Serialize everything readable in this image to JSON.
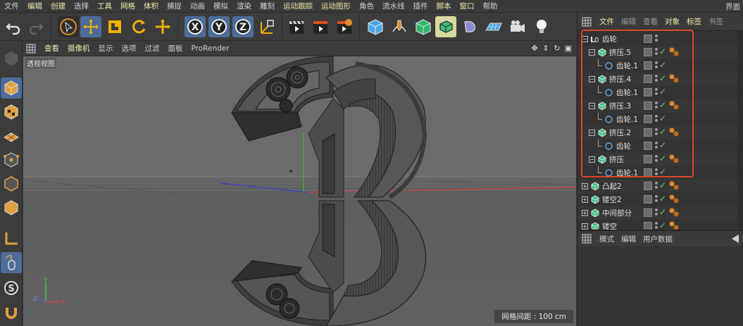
{
  "menu": {
    "items": [
      "文件",
      "编辑",
      "创建",
      "选择",
      "工具",
      "网格",
      "体积",
      "捕捉",
      "动画",
      "模拟",
      "渲染",
      "雕刻",
      "运动跟踪",
      "运动图形",
      "角色",
      "流水线",
      "插件",
      "脚本",
      "窗口",
      "帮助"
    ],
    "highlighted": [
      1,
      2,
      4,
      5,
      6,
      12,
      13,
      17,
      18
    ],
    "right_label": "界面"
  },
  "viewport_menu": {
    "items": [
      "查看",
      "摄像机",
      "显示",
      "选项",
      "过滤",
      "面板",
      "ProRender"
    ],
    "highlighted": [
      0,
      1
    ]
  },
  "viewport": {
    "label": "透视视图",
    "grid_spacing": "网格间距 : 100 cm",
    "axis_x": "X",
    "axis_y": "Y",
    "axis_z": "Z"
  },
  "object_manager": {
    "tabs": [
      "文件",
      "编辑",
      "查看",
      "对象",
      "标签",
      "书签"
    ],
    "highlighted_tabs": [
      0,
      3,
      4
    ],
    "rows": [
      {
        "name": "齿轮",
        "type": "null",
        "level": 0,
        "tag": false
      },
      {
        "name": "挤压.5",
        "type": "extrude",
        "level": 1,
        "tag": true
      },
      {
        "name": "齿轮.1",
        "type": "spline",
        "level": 2,
        "tag": false
      },
      {
        "name": "挤压.4",
        "type": "extrude",
        "level": 1,
        "tag": true
      },
      {
        "name": "齿轮.1",
        "type": "spline",
        "level": 2,
        "tag": false
      },
      {
        "name": "挤压.3",
        "type": "extrude",
        "level": 1,
        "tag": true
      },
      {
        "name": "齿轮.1",
        "type": "spline",
        "level": 2,
        "tag": false
      },
      {
        "name": "挤压.2",
        "type": "extrude",
        "level": 1,
        "tag": true
      },
      {
        "name": "齿轮",
        "type": "spline",
        "level": 2,
        "tag": false
      },
      {
        "name": "挤压",
        "type": "extrude",
        "level": 1,
        "tag": true
      },
      {
        "name": "齿轮.1",
        "type": "spline",
        "level": 2,
        "tag": false
      },
      {
        "name": "凸起2",
        "type": "extrude",
        "level": 0,
        "tag": true
      },
      {
        "name": "镂空2",
        "type": "extrude",
        "level": 0,
        "tag": true
      },
      {
        "name": "中间部分",
        "type": "extrude",
        "level": 0,
        "tag": true
      },
      {
        "name": "镂空",
        "type": "extrude",
        "level": 0,
        "tag": true
      }
    ]
  },
  "attribute_manager": {
    "tabs": [
      "模式",
      "编辑",
      "用户数据"
    ]
  },
  "colors": {
    "accent_blue": "#4c6d9c",
    "highlight_text": "#f0e6a8",
    "annotation_red": "#e0452a",
    "check_green": "#6ccf6c",
    "tag_orange": "#e08a2a"
  }
}
